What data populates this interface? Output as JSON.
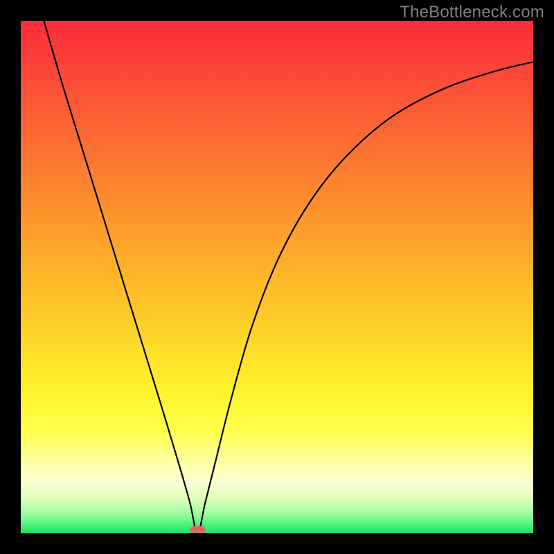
{
  "watermark": "TheBottleneck.com",
  "chart_data": {
    "type": "line",
    "title": "",
    "subtitle": "",
    "xlabel": "",
    "ylabel": "",
    "xlim": [
      0,
      100
    ],
    "ylim": [
      0,
      100
    ],
    "grid": false,
    "legend": false,
    "marker": {
      "x": 34.5,
      "y": 0
    },
    "annotations": [],
    "background_gradient": {
      "type": "linear-vertical",
      "stops": [
        {
          "offset": 0.0,
          "color": "#fc2b3b"
        },
        {
          "offset": 0.5,
          "color": "#fdb628"
        },
        {
          "offset": 0.72,
          "color": "#fef22a"
        },
        {
          "offset": 0.8,
          "color": "#ffff4a"
        },
        {
          "offset": 0.86,
          "color": "#ffffa0"
        },
        {
          "offset": 0.9,
          "color": "#fbffd4"
        },
        {
          "offset": 0.935,
          "color": "#dcffb7"
        },
        {
          "offset": 0.965,
          "color": "#94fc9c"
        },
        {
          "offset": 0.985,
          "color": "#49f07a"
        },
        {
          "offset": 1.0,
          "color": "#19e36a"
        }
      ]
    },
    "series": [
      {
        "name": "bottleneck-curve",
        "color": "#000000",
        "x": [
          4.5,
          8,
          12,
          16,
          20,
          24,
          28,
          31,
          33,
          34.5,
          36,
          38,
          41,
          45,
          50,
          56,
          63,
          72,
          82,
          92,
          100
        ],
        "y": [
          100,
          88,
          75,
          62,
          49,
          36,
          23,
          13,
          6,
          0,
          6,
          14,
          26,
          40,
          53,
          64,
          73,
          81,
          86.5,
          90,
          92
        ]
      }
    ]
  }
}
